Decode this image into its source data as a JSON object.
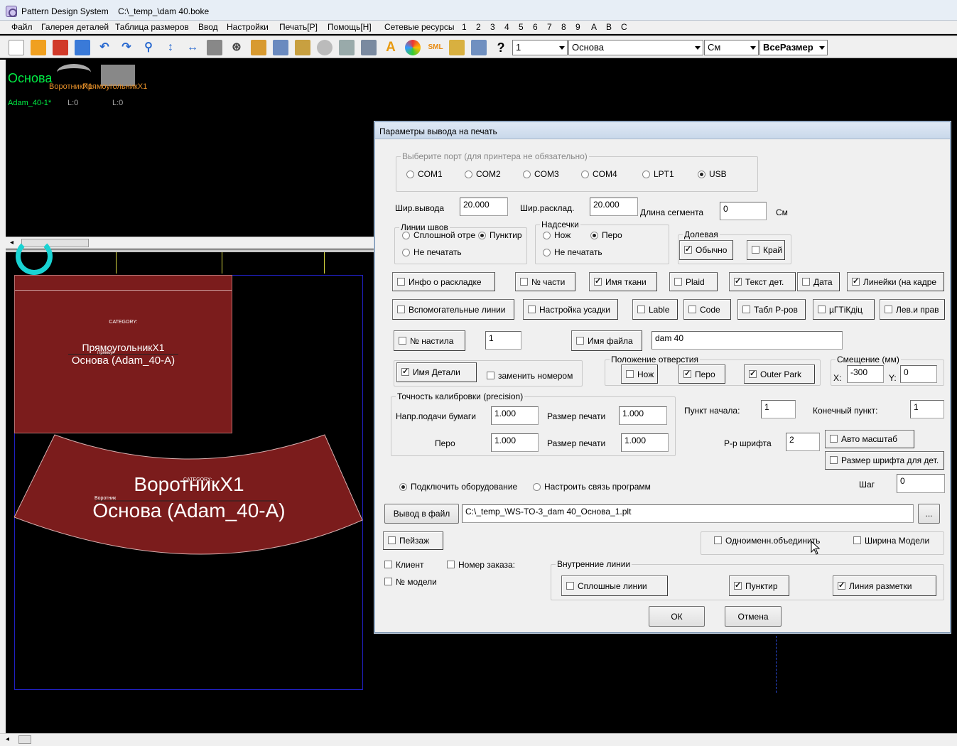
{
  "window": {
    "app_title": "Pattern Design System",
    "file_path": "C:\\_temp_\\dam 40.boke"
  },
  "menu": [
    "Файл",
    "Галерея деталей",
    "Таблица размеров",
    "Ввод",
    "Настройки",
    "Печать[P]",
    "Помощь[H]",
    "Сетевые ресурсы",
    "1",
    "2",
    "3",
    "4",
    "5",
    "6",
    "7",
    "8",
    "9",
    "A",
    "B",
    "C"
  ],
  "toolbar": {
    "icons": [
      "new-file-icon",
      "open-folder-icon",
      "save-icon",
      "add-piece-icon",
      "undo-icon",
      "redo-icon",
      "zoom-icon",
      "vertical-arrow-icon",
      "horizontal-arrow-icon",
      "eraser-icon",
      "target-icon",
      "layout-icon",
      "import-icon",
      "image-icon",
      "cd-icon",
      "tag-icon",
      "tools-icon",
      "text-a-icon",
      "color-wheel-icon",
      "sml-icon",
      "stack-icon",
      "figure-icon",
      "help-icon"
    ],
    "help_label": "?",
    "sml_label": "SML",
    "text_label": "A",
    "size_combo": "1",
    "base_combo": "Основа",
    "unit_combo": "См",
    "all_sizes_combo": "ВсеРазмер"
  },
  "canvas_top": {
    "title": "Основа",
    "piece_names": "ВоротникX1",
    "piece_names2": "ПрямоугольникX1",
    "model_name": "Adam_40-1*",
    "l1": "L:0",
    "l2": "L:0"
  },
  "canvas_bot": {
    "rect_category": "CATEGORY:",
    "rect_name": "ПрямоугольникX1",
    "rect_base": "Основа (Adam_40-A)",
    "rect_small": "Прямоуг",
    "collar_name": "ВоротникX1",
    "collar_base": "Основа (Adam_40-A)",
    "collar_small": "Воротник",
    "collar_category": "CATEGORY:"
  },
  "dialog": {
    "title": "Параметры вывода на печать",
    "port_group": "Выберите порт (для принтера не обязательно)",
    "ports": [
      {
        "label": "COM1",
        "selected": false
      },
      {
        "label": "COM2",
        "selected": false
      },
      {
        "label": "COM3",
        "selected": false
      },
      {
        "label": "COM4",
        "selected": false
      },
      {
        "label": "LPT1",
        "selected": false
      },
      {
        "label": "USB",
        "selected": true
      }
    ],
    "out_width_label": "Шир.вывода",
    "out_width": "20.000",
    "layout_width_label": "Шир.расклад.",
    "layout_width": "20.000",
    "segment_label": "Длина сегмента",
    "segment": "0",
    "unit": "См",
    "seam_group": "Линии швов",
    "seam_solid": "Сплошной отре",
    "seam_dotted": "Пунктир",
    "seam_none": "Не печатать",
    "notch_group": "Надсечки",
    "notch_knife": "Нож",
    "notch_pen": "Перо",
    "notch_none": "Не печатать",
    "grain_group": "Долевая",
    "grain_normal": "Обычно",
    "grain_edge": "Край",
    "cb_layout_info": "Инфо о раскладке",
    "cb_part_no": "№ части",
    "cb_fabric": "Имя ткани",
    "cb_plaid": "Plaid",
    "cb_piece_text": "Текст дет.",
    "cb_date": "Дата",
    "cb_rulers": "Линейки (на кадре",
    "cb_aux_lines": "Вспомогательные линии",
    "cb_shrink": "Настройка усадки",
    "cb_label": "Lable",
    "cb_code": "Code",
    "cb_size_table": "Табл Р-ров",
    "cb_garbled": "µГТiКдiц",
    "cb_left_right": "Лев.и прав",
    "cb_spread_no": "№ настила",
    "spread_no": "1",
    "cb_filename": "Имя файла",
    "filename": "dam 40",
    "cb_piece_name": "Имя Детали",
    "cb_replace_num": "заменить номером",
    "hole_group": "Положение отверстия",
    "hole_knife": "Нож",
    "hole_pen": "Перо",
    "hole_outer": "Outer Park",
    "offset_group": "Смещение (мм)",
    "offset_x_label": "X:",
    "offset_x": "-300",
    "offset_y_label": "Y:",
    "offset_y": "0",
    "calib_group": "Точность калибровки (precision)",
    "paper_feed_label": "Напр.подачи бумаги",
    "paper_feed": "1.000",
    "print_size_label": "Размер печати",
    "print_size": "1.000",
    "pen_label": "Перо",
    "pen_value": "1.000",
    "print_size2_label": "Размер печати",
    "print_size2": "1.000",
    "start_label": "Пункт начала:",
    "start_value": "1",
    "end_label": "Конечный пункт:",
    "end_value": "1",
    "font_size_label": "Р-р шрифта",
    "font_size": "2",
    "cb_auto_scale": "Авто масштаб",
    "cb_font_piece": "Размер шрифта для дет.",
    "rad_connect": "Подключить оборудование",
    "rad_config": "Настроить связь программ",
    "step_label": "Шаг",
    "step_value": "0",
    "output_file_btn": "Вывод в файл",
    "output_file": "C:\\_temp_\\WS-TO-3_dam 40_Основа_1.plt",
    "browse_btn": "...",
    "cb_landscape": "Пейзаж",
    "cb_same_name": "Одноименн.объединить",
    "cb_model_width": "Ширина Модели",
    "cb_client": "Клиент",
    "cb_order_no": "Номер заказа:",
    "cb_model_no": "№ модели",
    "inner_group": "Внутренние линии",
    "cb_solid_lines": "Сплошные линии",
    "cb_dotted": "Пунктир",
    "cb_marking": "Линия разметки",
    "ok_btn": "ОК",
    "cancel_btn": "Отмена"
  },
  "colors": {
    "piece_fill": "#7b1c1c",
    "base_text_green": "#00ee44",
    "dialog_bg": "#f0f0f0"
  }
}
